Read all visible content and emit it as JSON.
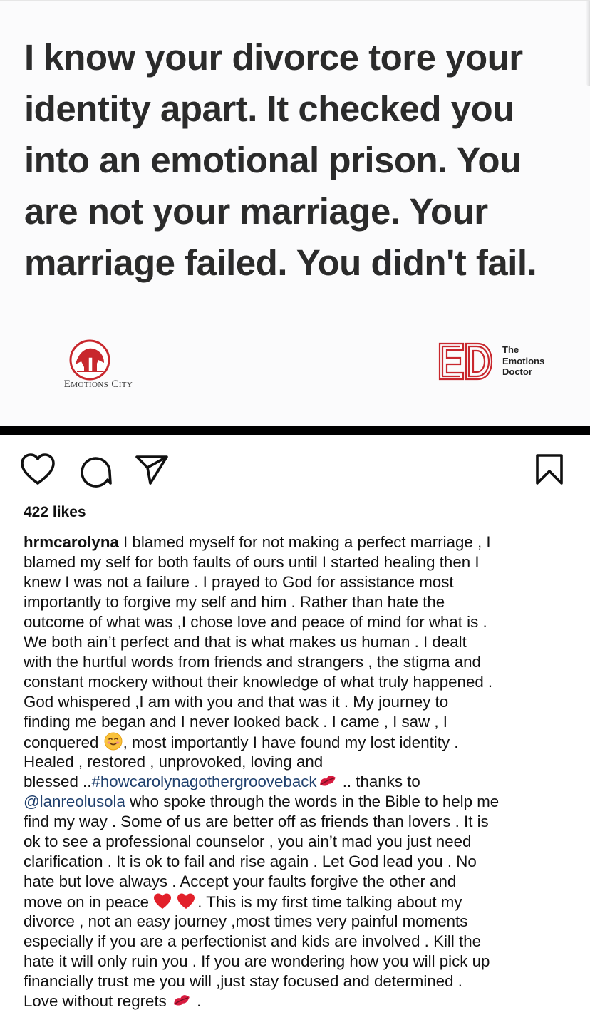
{
  "post_image": {
    "quote_lines": [
      "I know your divorce tore your",
      "identity apart. It checked you",
      "into an emotional prison. You",
      "are not your marriage. Your",
      "marriage failed. You didn't fail."
    ],
    "left_logo_text": "Emotions City",
    "right_logo_text_lines": [
      "The",
      "Emotions",
      "Doctor"
    ],
    "right_logo_monogram": "ED"
  },
  "actions": {
    "like_icon": "heart-icon",
    "comment_icon": "comment-icon",
    "share_icon": "paper-plane-icon",
    "save_icon": "bookmark-icon"
  },
  "likes": "422 likes",
  "caption": {
    "username": "hrmcarolyna",
    "lines": [
      {
        "before": " I blamed myself for not making  a perfect marriage , I"
      },
      {
        "before": "blamed my self for both faults of ours until I started healing then I"
      },
      {
        "before": "knew I was not a failure . I prayed to God for assistance most"
      },
      {
        "before": "importantly to forgive my self and him . Rather than hate the"
      },
      {
        "before": "outcome of what was ,I chose love and peace of mind for what is ."
      },
      {
        "before": "We both ain’t perfect and that is what makes us human . I dealt"
      },
      {
        "before": "with the hurtful words from friends and strangers , the stigma and"
      },
      {
        "before": "constant mockery without their knowledge of what truly happened ."
      },
      {
        "before": "God whispered ,I am with you and that was it . My journey to"
      },
      {
        "before": "finding me began and I never looked back . I came , I saw , I"
      },
      {
        "before": "conquered ",
        "emoji": "smiling-face",
        "after": ", most importantly I have found my lost identity ."
      },
      {
        "before": "Healed , restored , unprovoked, loving and"
      },
      {
        "before": "blessed ..",
        "link": "#howcarolynagothergrooveback",
        "emoji": "kiss-mark",
        "after": " .. thanks to"
      },
      {
        "link": "@lanreolusola",
        "after": " who spoke through the words in the Bible to help me"
      },
      {
        "before": "find my way . Some of us are better off as friends than lovers . It is"
      },
      {
        "before": "ok to see a professional counselor , you ain’t mad you just need"
      },
      {
        "before": "clarification . It is ok to fail and rise again . Let God lead you . No"
      },
      {
        "before": "hate but love always . Accept your faults forgive the other and"
      },
      {
        "before": "move on in peace ",
        "emoji": "two-red-hearts",
        "after": ". This is my first time talking about my"
      },
      {
        "before": "divorce , not an easy journey ,most times very painful moments"
      },
      {
        "before": "especially if you are a perfectionist and kids are involved . Kill the"
      },
      {
        "before": "hate it will only ruin you . If you are wondering how you will pick up"
      },
      {
        "before": "financially trust me you will ,just stay focused and determined ."
      },
      {
        "before": "Love without regrets ",
        "emoji": "kiss-mark",
        "after": " ."
      }
    ]
  },
  "colors": {
    "link": "#20406d",
    "logo_red": "#c8272d"
  }
}
